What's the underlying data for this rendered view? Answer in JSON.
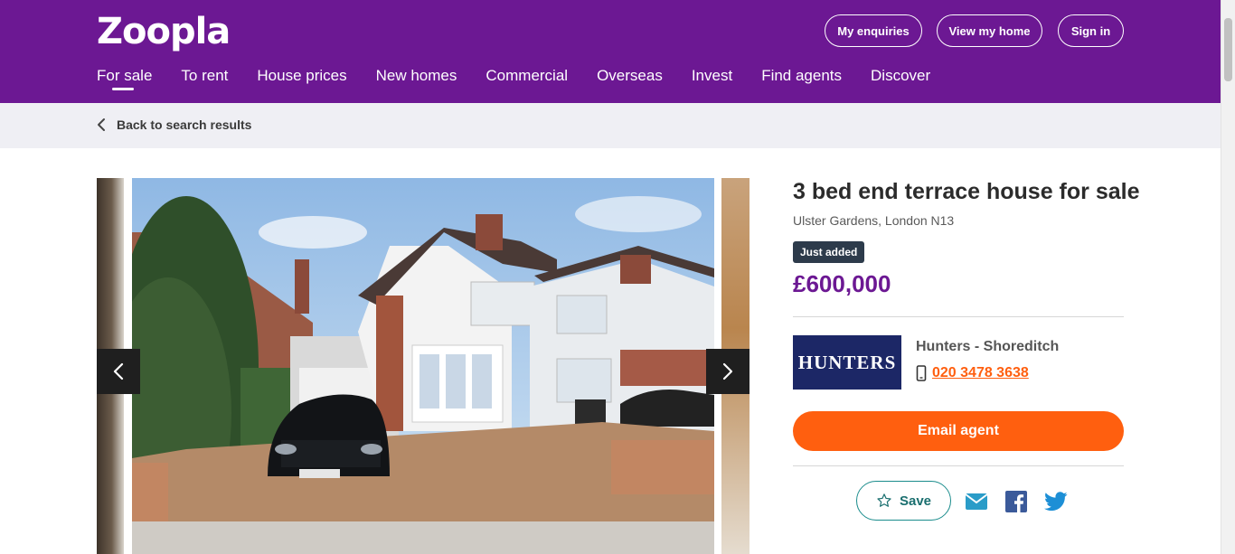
{
  "header": {
    "logo": "Zoopla",
    "buttons": [
      "My enquiries",
      "View my home",
      "Sign in"
    ],
    "nav": [
      "For sale",
      "To rent",
      "House prices",
      "New homes",
      "Commercial",
      "Overseas",
      "Invest",
      "Find agents",
      "Discover"
    ],
    "active_nav": "For sale"
  },
  "subbar": {
    "back_label": "Back to search results"
  },
  "listing": {
    "title": "3 bed end terrace house for sale",
    "address": "Ulster Gardens, London N13",
    "badge": "Just added",
    "price": "£600,000"
  },
  "agent": {
    "logo_text": "HUNTERS",
    "name": "Hunters - Shoreditch",
    "phone": "020 3478 3638"
  },
  "actions": {
    "email_label": "Email agent",
    "save_label": "Save",
    "share": [
      "email-icon",
      "facebook-icon",
      "twitter-icon"
    ]
  },
  "colors": {
    "brand_purple": "#6c1893",
    "accent_orange": "#ff5f0f",
    "teal": "#1a8c8c",
    "agent_navy": "#1c2766"
  }
}
